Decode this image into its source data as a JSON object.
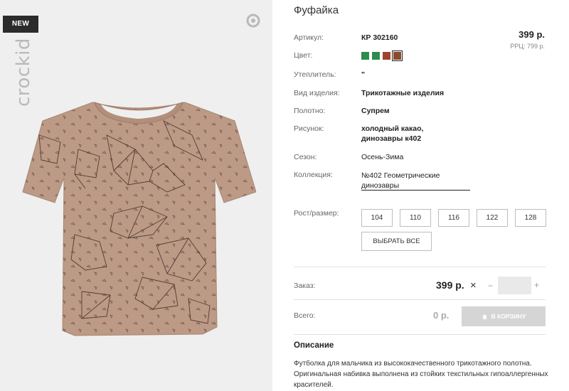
{
  "image": {
    "badge": "NEW",
    "brand": "crockid"
  },
  "product": {
    "title": "Фуфайка",
    "price": "399 р.",
    "rrp": "РРЦ: 799 р."
  },
  "details": {
    "article_label": "Артикул:",
    "article_value": "КР 302160",
    "color_label": "Цвет:",
    "swatches": [
      "#2e8b4e",
      "#2e8b4e",
      "#a0432d",
      "#8a4a2e"
    ],
    "insulation_label": "Утеплитель:",
    "insulation_value": "\"",
    "type_label": "Вид изделия:",
    "type_value": "Трикотажные изделия",
    "fabric_label": "Полотно:",
    "fabric_value": "Супрем",
    "pattern_label": "Рисунок:",
    "pattern_line1": "холодный какао,",
    "pattern_line2": "динозавры к402",
    "season_label": "Сезон:",
    "season_value": "Осень-Зима",
    "collection_label": "Коллекция:",
    "collection_line1": "№402 Геометрические",
    "collection_line2": "динозавры"
  },
  "sizes": {
    "label": "Рост/размер:",
    "options": [
      "104",
      "110",
      "116",
      "122",
      "128"
    ],
    "select_all": "ВЫБРАТЬ ВСЕ"
  },
  "order": {
    "label": "Заказ:",
    "price": "399 р.",
    "times": "×",
    "minus": "−",
    "plus": "+",
    "quantity": ""
  },
  "total": {
    "label": "Всего:",
    "value": "0 р.",
    "cart_button": "В КОРЗИНУ"
  },
  "description": {
    "heading": "Описание",
    "text": "Футболка для мальчика из высококачественного трикотажного полотна. Оригинальная набивка выполнена из стойких текстильных гипоаллергенных красителей."
  }
}
